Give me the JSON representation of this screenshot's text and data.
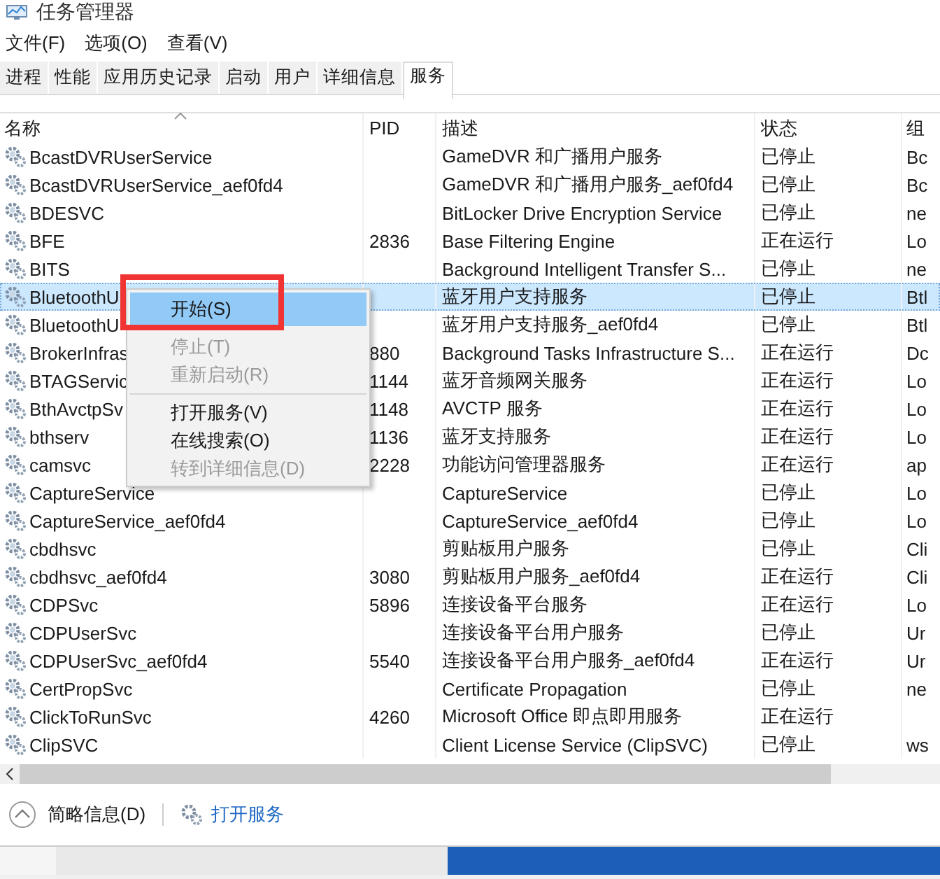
{
  "window": {
    "title": "任务管理器"
  },
  "menu": [
    "文件(F)",
    "选项(O)",
    "查看(V)"
  ],
  "tabs": [
    {
      "label": "进程",
      "selected": false
    },
    {
      "label": "性能",
      "selected": false
    },
    {
      "label": "应用历史记录",
      "selected": false
    },
    {
      "label": "启动",
      "selected": false
    },
    {
      "label": "用户",
      "selected": false
    },
    {
      "label": "详细信息",
      "selected": false
    },
    {
      "label": "服务",
      "selected": true
    }
  ],
  "table": {
    "columns": [
      "名称",
      "PID",
      "描述",
      "状态",
      "组"
    ],
    "rows": [
      {
        "name": "BcastDVRUserService",
        "pid": "",
        "description": "GameDVR 和广播用户服务",
        "status": "已停止",
        "group": "Bc",
        "selected": false
      },
      {
        "name": "BcastDVRUserService_aef0fd4",
        "pid": "",
        "description": "GameDVR 和广播用户服务_aef0fd4",
        "status": "已停止",
        "group": "Bc",
        "selected": false
      },
      {
        "name": "BDESVC",
        "pid": "",
        "description": "BitLocker Drive Encryption Service",
        "status": "已停止",
        "group": "ne",
        "selected": false
      },
      {
        "name": "BFE",
        "pid": "2836",
        "description": "Base Filtering Engine",
        "status": "正在运行",
        "group": "Lo",
        "selected": false
      },
      {
        "name": "BITS",
        "pid": "",
        "description": "Background Intelligent Transfer S...",
        "status": "已停止",
        "group": "ne",
        "selected": false
      },
      {
        "name": "BluetoothU",
        "pid": "",
        "description": "蓝牙用户支持服务",
        "status": "已停止",
        "group": "Btl",
        "selected": true
      },
      {
        "name": "BluetoothU",
        "pid": "",
        "description": "蓝牙用户支持服务_aef0fd4",
        "status": "已停止",
        "group": "Btl",
        "selected": false
      },
      {
        "name": "BrokerInfras",
        "pid": "880",
        "description": "Background Tasks Infrastructure S...",
        "status": "正在运行",
        "group": "Dc",
        "selected": false
      },
      {
        "name": "BTAGServic",
        "pid": "1144",
        "description": "蓝牙音频网关服务",
        "status": "正在运行",
        "group": "Lo",
        "selected": false
      },
      {
        "name": "BthAvctpSv",
        "pid": "1148",
        "description": "AVCTP 服务",
        "status": "正在运行",
        "group": "Lo",
        "selected": false
      },
      {
        "name": "bthserv",
        "pid": "1136",
        "description": "蓝牙支持服务",
        "status": "正在运行",
        "group": "Lo",
        "selected": false
      },
      {
        "name": "camsvc",
        "pid": "2228",
        "description": "功能访问管理器服务",
        "status": "正在运行",
        "group": "ap",
        "selected": false
      },
      {
        "name": "CaptureService",
        "pid": "",
        "description": "CaptureService",
        "status": "已停止",
        "group": "Lo",
        "selected": false
      },
      {
        "name": "CaptureService_aef0fd4",
        "pid": "",
        "description": "CaptureService_aef0fd4",
        "status": "已停止",
        "group": "Lo",
        "selected": false
      },
      {
        "name": "cbdhsvc",
        "pid": "",
        "description": "剪贴板用户服务",
        "status": "已停止",
        "group": "Cli",
        "selected": false
      },
      {
        "name": "cbdhsvc_aef0fd4",
        "pid": "3080",
        "description": "剪贴板用户服务_aef0fd4",
        "status": "正在运行",
        "group": "Cli",
        "selected": false
      },
      {
        "name": "CDPSvc",
        "pid": "5896",
        "description": "连接设备平台服务",
        "status": "正在运行",
        "group": "Lo",
        "selected": false
      },
      {
        "name": "CDPUserSvc",
        "pid": "",
        "description": "连接设备平台用户服务",
        "status": "已停止",
        "group": "Ur",
        "selected": false
      },
      {
        "name": "CDPUserSvc_aef0fd4",
        "pid": "5540",
        "description": "连接设备平台用户服务_aef0fd4",
        "status": "正在运行",
        "group": "Ur",
        "selected": false
      },
      {
        "name": "CertPropSvc",
        "pid": "",
        "description": "Certificate Propagation",
        "status": "已停止",
        "group": "ne",
        "selected": false
      },
      {
        "name": "ClickToRunSvc",
        "pid": "4260",
        "description": "Microsoft Office 即点即用服务",
        "status": "正在运行",
        "group": "",
        "selected": false
      },
      {
        "name": "ClipSVC",
        "pid": "",
        "description": "Client License Service (ClipSVC)",
        "status": "已停止",
        "group": "ws",
        "selected": false
      }
    ]
  },
  "context_menu": [
    {
      "kind": "item",
      "label": "开始(S)",
      "disabled": false,
      "selected": true
    },
    {
      "kind": "item",
      "label": "停止(T)",
      "disabled": true,
      "selected": false
    },
    {
      "kind": "item",
      "label": "重新启动(R)",
      "disabled": true,
      "selected": false
    },
    {
      "kind": "separator"
    },
    {
      "kind": "item",
      "label": "打开服务(V)",
      "disabled": false,
      "selected": false
    },
    {
      "kind": "item",
      "label": "在线搜索(O)",
      "disabled": false,
      "selected": false
    },
    {
      "kind": "item",
      "label": "转到详细信息(D)",
      "disabled": true,
      "selected": false
    }
  ],
  "footer": {
    "summary": "简略信息(D)",
    "open_services": "打开服务"
  }
}
